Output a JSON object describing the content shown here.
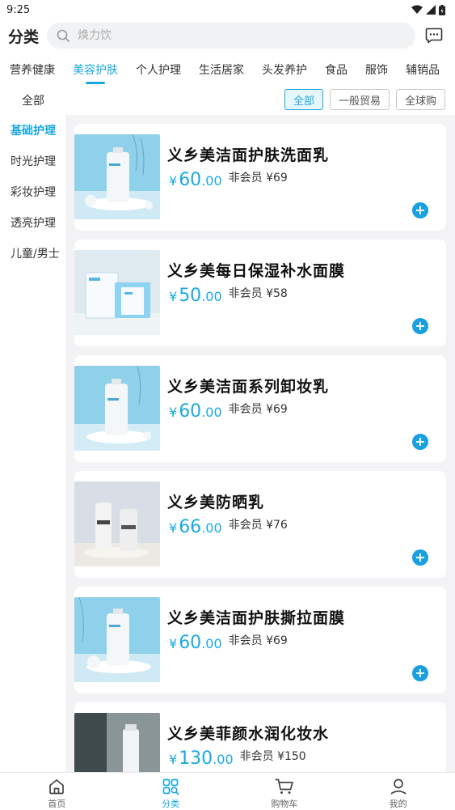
{
  "status": {
    "time": "9:25"
  },
  "header": {
    "title": "分类",
    "search_placeholder": "焕力饮"
  },
  "category_tabs": [
    {
      "label": "营养健康",
      "active": false
    },
    {
      "label": "美容护肤",
      "active": true
    },
    {
      "label": "个人护理",
      "active": false
    },
    {
      "label": "生活居家",
      "active": false
    },
    {
      "label": "头发养护",
      "active": false
    },
    {
      "label": "食品",
      "active": false
    },
    {
      "label": "服饰",
      "active": false
    },
    {
      "label": "辅销品",
      "active": false
    },
    {
      "label": "全部",
      "active": false
    }
  ],
  "filter": {
    "all_label": "全部",
    "chips": [
      {
        "label": "全部",
        "active": true
      },
      {
        "label": "一般贸易",
        "active": false
      },
      {
        "label": "全球购",
        "active": false
      }
    ]
  },
  "sidebar": {
    "items": [
      {
        "label": "基础护理",
        "active": true
      },
      {
        "label": "时光护理",
        "active": false
      },
      {
        "label": "彩妆护理",
        "active": false
      },
      {
        "label": "透亮护理",
        "active": false
      },
      {
        "label": "儿童/男士",
        "active": false
      }
    ]
  },
  "products": [
    {
      "name": "义乡美洁面护肤洗面乳",
      "currency": "¥",
      "price_int": "60",
      "price_dec": ".00",
      "nonmember": "非会员 ¥69",
      "image": "cleanser-tube-blue-bg"
    },
    {
      "name": "义乡美每日保湿补水面膜",
      "currency": "¥",
      "price_int": "50",
      "price_dec": ".00",
      "nonmember": "非会员 ¥58",
      "image": "mask-box"
    },
    {
      "name": "义乡美洁面系列卸妆乳",
      "currency": "¥",
      "price_int": "60",
      "price_dec": ".00",
      "nonmember": "非会员 ¥69",
      "image": "makeup-remover-tube"
    },
    {
      "name": "义乡美防晒乳",
      "currency": "¥",
      "price_int": "66",
      "price_dec": ".00",
      "nonmember": "非会员 ¥76",
      "image": "sunscreen-tubes"
    },
    {
      "name": "义乡美洁面护肤撕拉面膜",
      "currency": "¥",
      "price_int": "60",
      "price_dec": ".00",
      "nonmember": "非会员 ¥69",
      "image": "peel-mask-tube"
    },
    {
      "name": "义乡美菲颜水润化妆水",
      "currency": "¥",
      "price_int": "130",
      "price_dec": ".00",
      "nonmember": "非会员 ¥150",
      "image": "toner-bottle"
    }
  ],
  "bottom_nav": [
    {
      "label": "首页",
      "icon": "home-icon",
      "active": false
    },
    {
      "label": "分类",
      "icon": "category-icon",
      "active": true
    },
    {
      "label": "购物车",
      "icon": "cart-icon",
      "active": false
    },
    {
      "label": "我的",
      "icon": "profile-icon",
      "active": false
    }
  ],
  "colors": {
    "accent": "#1ba9e1",
    "add_button": "#1a9fe0",
    "content_bg": "#f3f3f5"
  }
}
